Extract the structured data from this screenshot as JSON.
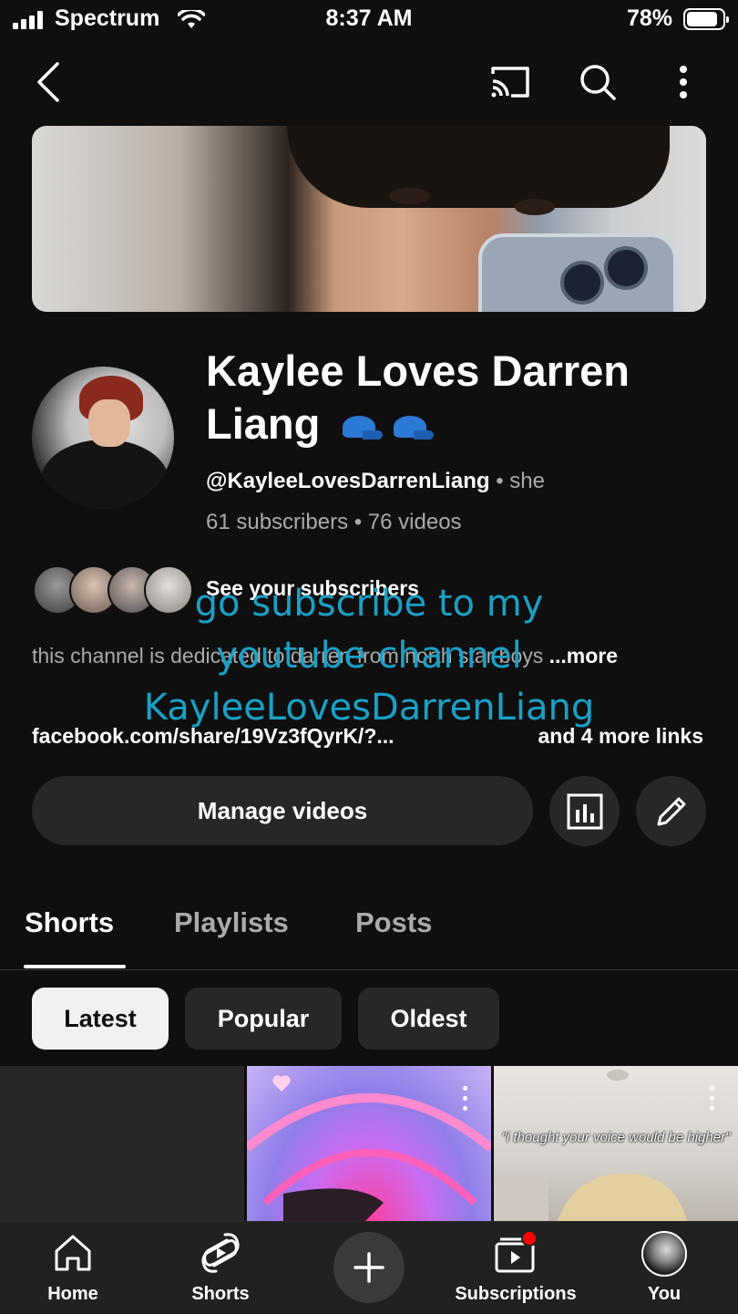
{
  "status_bar": {
    "carrier": "Spectrum",
    "time": "8:37 AM",
    "battery_percent": "78%",
    "battery_level": 0.78
  },
  "top_bar": {
    "icons": [
      "back-arrow-icon",
      "cast-icon",
      "search-icon",
      "more-vertical-icon"
    ]
  },
  "channel": {
    "name": "Kaylee Loves Darren Liang",
    "name_emoji": "🧢🧢",
    "handle": "@KayleeLovesDarrenLiang",
    "separator": "•",
    "pronouns": "she",
    "stats": "61 subscribers • 76 videos",
    "see_subscribers": "See your subscribers",
    "description": "this channel is dedicated to darren from north star boys",
    "description_more": "...more",
    "link": "facebook.com/share/19Vz3fQyrK/?...",
    "more_links": "and 4 more links"
  },
  "overlay_text": {
    "line1": "go subscribe to my",
    "line2": "youtube channel",
    "line3": "KayleeLovesDarrenLiang",
    "color": "#1aa0c6"
  },
  "actions": {
    "manage_videos": "Manage videos",
    "icons": [
      "analytics-icon",
      "edit-pencil-icon"
    ]
  },
  "tabs": [
    {
      "label": "Shorts",
      "active": true
    },
    {
      "label": "Playlists",
      "active": false
    },
    {
      "label": "Posts",
      "active": false
    }
  ],
  "filters": [
    {
      "label": "Latest",
      "selected": true
    },
    {
      "label": "Popular",
      "selected": false
    },
    {
      "label": "Oldest",
      "selected": false
    }
  ],
  "shorts": [
    {
      "caption": ""
    },
    {
      "caption": ""
    },
    {
      "caption": "\"i thought your voice would be higher\""
    }
  ],
  "bottom_nav": [
    {
      "label": "Home",
      "icon": "home-icon"
    },
    {
      "label": "Shorts",
      "icon": "shorts-icon"
    },
    {
      "label": "",
      "icon": "create-plus-icon"
    },
    {
      "label": "Subscriptions",
      "icon": "subscriptions-icon",
      "badge": true
    },
    {
      "label": "You",
      "icon": "profile-avatar-icon"
    }
  ],
  "colors": {
    "background": "#0f0f0f",
    "surface": "#272727",
    "text_secondary": "#aaaaaa",
    "badge": "#ff0000"
  }
}
